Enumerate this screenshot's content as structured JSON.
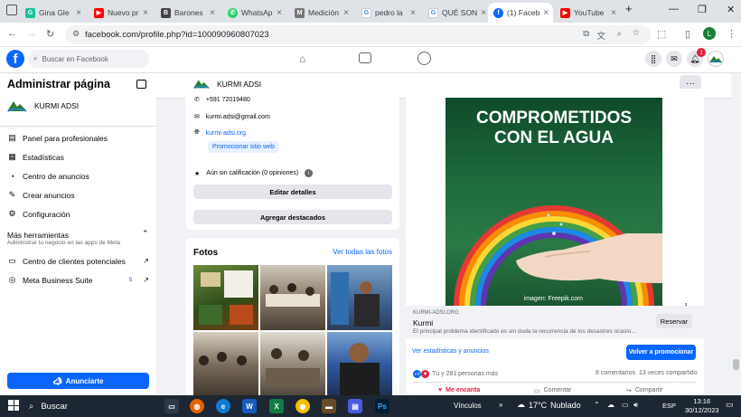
{
  "browser": {
    "tabs": [
      {
        "label": "Gina Gle",
        "icon": "grammarly-icon",
        "active": false
      },
      {
        "label": "Nuevo pr",
        "icon": "youtube-icon",
        "active": false
      },
      {
        "label": "Barones",
        "icon": "web-icon",
        "active": false
      },
      {
        "label": "WhatsAp",
        "icon": "whatsapp-icon",
        "active": false
      },
      {
        "label": "Medición",
        "icon": "web-icon",
        "active": false
      },
      {
        "label": "pedro la",
        "icon": "google-icon",
        "active": false
      },
      {
        "label": "QUÉ SON",
        "icon": "google-icon",
        "active": false
      },
      {
        "label": "(1) Faceb",
        "icon": "facebook-icon",
        "active": true
      },
      {
        "label": "YouTube",
        "icon": "youtube-icon",
        "active": false
      }
    ],
    "url": "facebook.com/profile.php?id=100090960807023",
    "profile_initial": "L"
  },
  "facebook": {
    "search_placeholder": "Buscar en Facebook",
    "notification_count": "1"
  },
  "sidebar": {
    "title": "Administrar página",
    "page_name": "KURMI ADSI",
    "items": [
      {
        "label": "Panel para profesionales",
        "icon": "dashboard-icon"
      },
      {
        "label": "Estadísticas",
        "icon": "stats-icon"
      },
      {
        "label": "Centro de anuncios",
        "icon": "ads-icon"
      },
      {
        "label": "Crear anuncios",
        "icon": "pencil-icon"
      },
      {
        "label": "Configuración",
        "icon": "gear-icon"
      }
    ],
    "more_tools_title": "Más herramientas",
    "more_tools_subtitle": "Administrar tu negocio en las apps de Meta",
    "tools": [
      {
        "label": "Centro de clientes potenciales",
        "badge": ""
      },
      {
        "label": "Meta Business Suite",
        "badge": "5"
      }
    ],
    "promote_button": "Anunciarte"
  },
  "page_header": {
    "name": "KURMI ADSI"
  },
  "intro": {
    "phone": "+591 72019480",
    "email": "kurmi.adsi@gmail.com",
    "website": "kurmi-adsi.org",
    "promote_website": "Promocionar sitio web",
    "rating": "Aún sin calificación (0 opiniones)",
    "edit_details": "Editar detalles",
    "add_featured": "Agregar destacados"
  },
  "photos": {
    "title": "Fotos",
    "see_all": "Ver todas las fotos"
  },
  "post": {
    "image_title_line1": "COMPROMETIDOS",
    "image_title_line2": "CON EL AGUA",
    "image_credit": "imagen: Freepik.com",
    "link_domain": "KURMI-ADSI.ORG",
    "link_title": "Kurmi",
    "link_description": "El principal problema identificado es sin duda la recurrencia de los desastres ocasio...",
    "reserve_button": "Reservar",
    "stats_link": "Ver estadísticas y anuncios",
    "promote_again": "Volver a promocionar",
    "reactions": "Tú y 281 personas más",
    "comments": "8 comentarios",
    "shares": "13 veces compartido",
    "like_label": "Me encanta",
    "comment_label": "Comentar",
    "share_label": "Compartir"
  },
  "taskbar": {
    "search": "Buscar",
    "links": "Vínculos",
    "weather_temp": "17°C",
    "weather_text": "Nublado",
    "language": "ESP",
    "time": "13:16",
    "date": "30/12/2023"
  },
  "colors": {
    "facebook_blue": "#0866ff",
    "like_red": "#e41e3f",
    "taskbar": "#1c2733"
  }
}
